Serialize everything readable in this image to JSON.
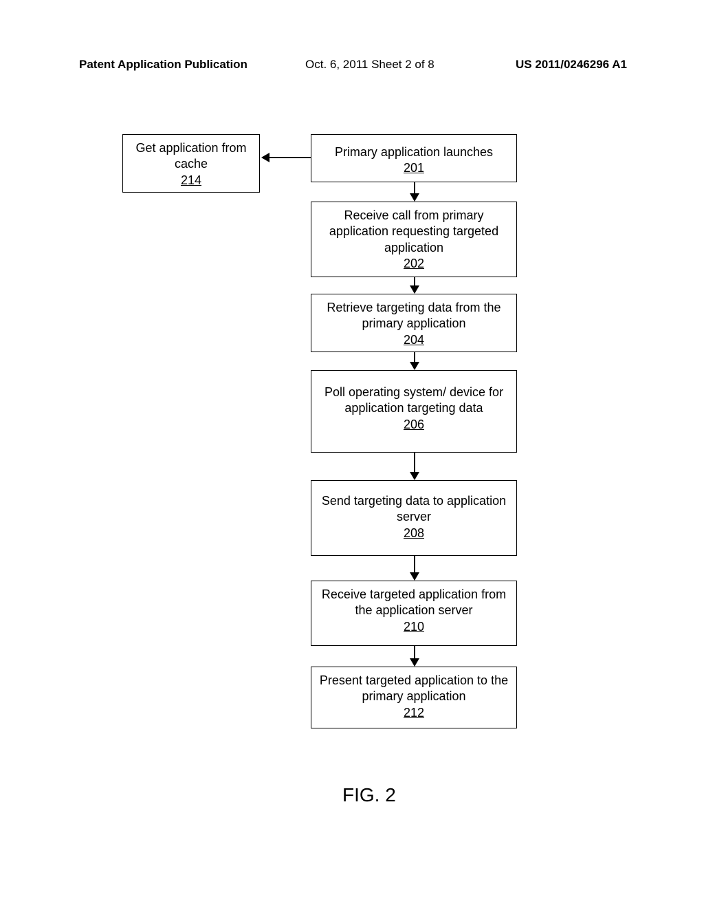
{
  "header": {
    "left": "Patent Application Publication",
    "center": "Oct. 6, 2011  Sheet 2 of 8",
    "right": "US 2011/0246296 A1"
  },
  "boxes": {
    "b214": {
      "text": "Get application from cache",
      "ref": "214"
    },
    "b201": {
      "text": "Primary application launches",
      "ref": "201"
    },
    "b202": {
      "text": "Receive call from primary application requesting targeted application",
      "ref": "202"
    },
    "b204": {
      "text": "Retrieve targeting data from the primary application",
      "ref": "204"
    },
    "b206": {
      "text": "Poll operating system/ device for application targeting data",
      "ref": "206"
    },
    "b208": {
      "text": "Send targeting data to application server",
      "ref": "208"
    },
    "b210": {
      "text": "Receive targeted application from the application server",
      "ref": "210"
    },
    "b212": {
      "text": "Present targeted application to the primary application",
      "ref": "212"
    }
  },
  "figure_label": "FIG. 2",
  "chart_data": {
    "type": "flowchart",
    "nodes": [
      {
        "id": "214",
        "label": "Get application from cache"
      },
      {
        "id": "201",
        "label": "Primary application launches"
      },
      {
        "id": "202",
        "label": "Receive call from primary application requesting targeted application"
      },
      {
        "id": "204",
        "label": "Retrieve targeting data from the primary application"
      },
      {
        "id": "206",
        "label": "Poll operating system/ device for application targeting data"
      },
      {
        "id": "208",
        "label": "Send targeting data to application server"
      },
      {
        "id": "210",
        "label": "Receive targeted application from the application server"
      },
      {
        "id": "212",
        "label": "Present targeted application to the primary application"
      }
    ],
    "edges": [
      {
        "from": "201",
        "to": "214"
      },
      {
        "from": "201",
        "to": "202"
      },
      {
        "from": "202",
        "to": "204"
      },
      {
        "from": "204",
        "to": "206"
      },
      {
        "from": "206",
        "to": "208"
      },
      {
        "from": "208",
        "to": "210"
      },
      {
        "from": "210",
        "to": "212"
      }
    ]
  }
}
